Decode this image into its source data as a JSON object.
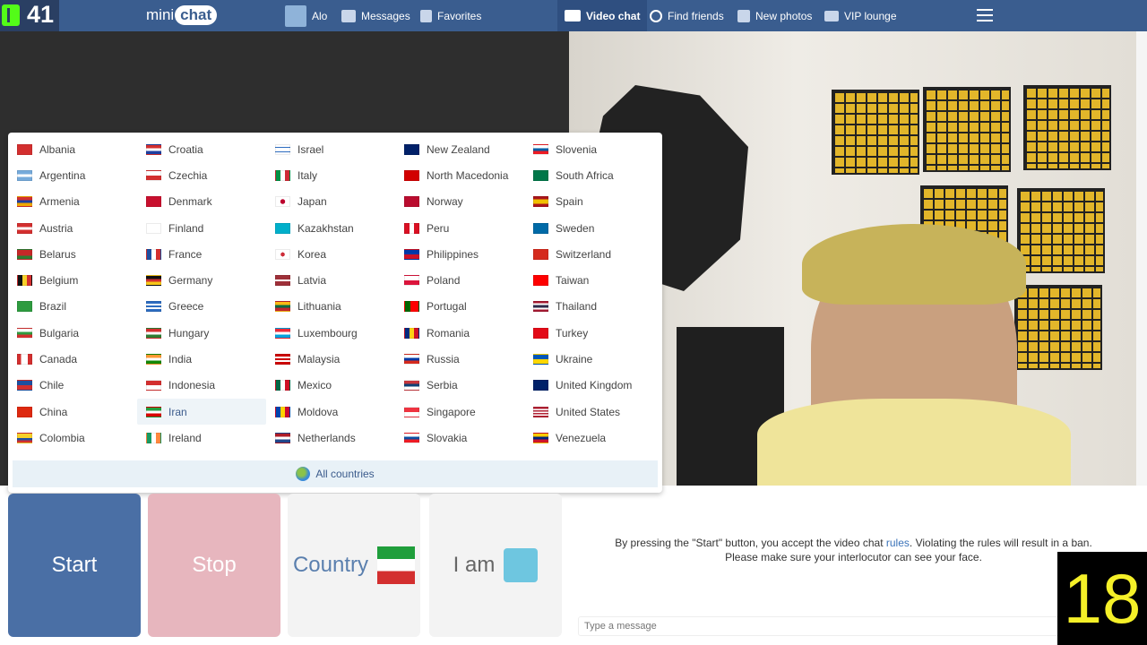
{
  "top": {
    "logo_number": "41",
    "brand_mini": "mini",
    "brand_chat": "chat",
    "nav": [
      {
        "label": "Alo",
        "icon": "profile-icon"
      },
      {
        "label": "Messages",
        "icon": "envelope-icon"
      },
      {
        "label": "Favorites",
        "icon": "flag-icon"
      },
      {
        "label": "Video chat",
        "icon": "video-icon"
      },
      {
        "label": "Find friends",
        "icon": "search-icon"
      },
      {
        "label": "New photos",
        "icon": "grid-icon"
      },
      {
        "label": "VIP lounge",
        "icon": "crown-icon"
      }
    ]
  },
  "countries": {
    "columns": [
      [
        "Albania",
        "Argentina",
        "Armenia",
        "Austria",
        "Belarus",
        "Belgium",
        "Brazil",
        "Bulgaria",
        "Canada",
        "Chile",
        "China",
        "Colombia"
      ],
      [
        "Croatia",
        "Czechia",
        "Denmark",
        "Finland",
        "France",
        "Germany",
        "Greece",
        "Hungary",
        "India",
        "Indonesia",
        "Iran",
        "Ireland"
      ],
      [
        "Israel",
        "Italy",
        "Japan",
        "Kazakhstan",
        "Korea",
        "Latvia",
        "Lithuania",
        "Luxembourg",
        "Malaysia",
        "Mexico",
        "Moldova",
        "Netherlands"
      ],
      [
        "New Zealand",
        "North Macedonia",
        "Norway",
        "Peru",
        "Philippines",
        "Poland",
        "Portugal",
        "Romania",
        "Russia",
        "Serbia",
        "Singapore",
        "Slovakia"
      ],
      [
        "Slovenia",
        "South Africa",
        "Spain",
        "Sweden",
        "Switzerland",
        "Taiwan",
        "Thailand",
        "Turkey",
        "Ukraine",
        "United Kingdom",
        "United States",
        "Venezuela"
      ]
    ],
    "highlighted": "Iran",
    "all_label": "All countries"
  },
  "buttons": {
    "start": "Start",
    "stop": "Stop",
    "country": "Country",
    "iam": "I am"
  },
  "info": {
    "line1_pre": "By pressing the \"Start\" button, you accept the video chat ",
    "rules_link": "rules",
    "line1_post": ". Violating the rules will result in a ban.",
    "line2": "Please make sure your interlocutor can see your face."
  },
  "message": {
    "placeholder": "Type a message"
  },
  "overlay_number": "18",
  "colors": {
    "topbar": "#3a5d8f",
    "start": "#4a6fa5",
    "stop": "#e7b6be",
    "link": "#3b73b9",
    "overlay_text": "#f5f028"
  }
}
